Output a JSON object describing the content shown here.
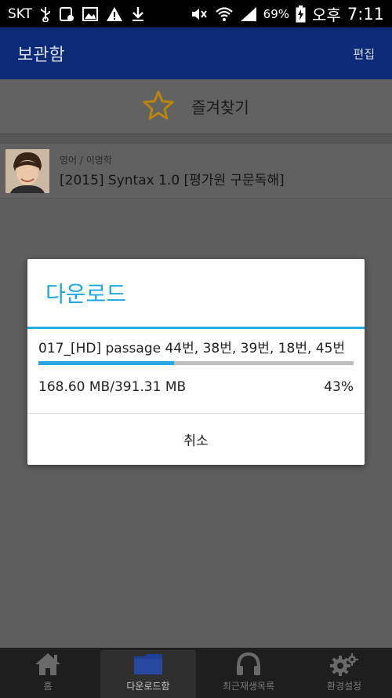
{
  "status_bar": {
    "carrier": "SKT",
    "battery": "69%",
    "ampm": "오후",
    "time": "7:11"
  },
  "app_bar": {
    "title": "보관함",
    "edit_label": "편집"
  },
  "favorites": {
    "label": "즐겨찾기"
  },
  "lecture": {
    "subtitle": "영어 / 이명학",
    "title": "[2015] Syntax 1.0 [평가원 구문독해]"
  },
  "download_dialog": {
    "title": "다운로드",
    "file_name": "017_[HD] passage 44번, 38번, 39번, 18번, 45번",
    "size_text": "168.60 MB/391.31 MB",
    "percent_text": "43%",
    "progress": 0.43,
    "cancel_label": "취소"
  },
  "bottom_nav": {
    "items": [
      {
        "label": "홈",
        "icon": "home-icon"
      },
      {
        "label": "다운로드함",
        "icon": "folder-icon"
      },
      {
        "label": "최근재생목록",
        "icon": "headphones-icon"
      },
      {
        "label": "환경설정",
        "icon": "gear-icon"
      }
    ]
  },
  "colors": {
    "app_bar": "#0d2a78",
    "accent": "#27aee0",
    "star": "#d6a41c"
  }
}
